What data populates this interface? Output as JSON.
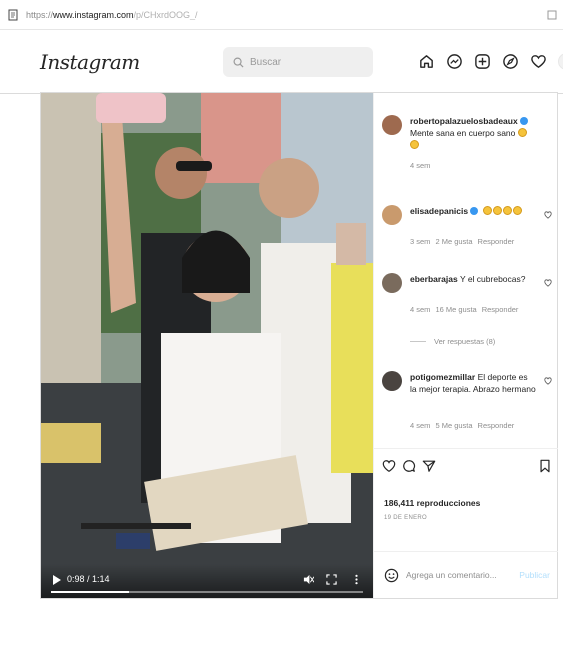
{
  "browser": {
    "url_scheme": "https://",
    "url_host": "www.instagram.com",
    "url_path": "/p/CHxrdOOG_/"
  },
  "nav": {
    "logo": "Instagram",
    "search_placeholder": "Buscar",
    "icons": [
      "home-icon",
      "messenger-icon",
      "new-post-icon",
      "explore-icon",
      "activity-heart-icon",
      "profile-avatar"
    ]
  },
  "video": {
    "time": "0:98 / 1:14",
    "progress_fraction": 0.25
  },
  "caption": {
    "username": "robertopalazuelosbadeaux",
    "text": "Mente sana en cuerpo sano",
    "time": "4 sem"
  },
  "comments": [
    {
      "username": "elisadepanicis",
      "text": "",
      "time": "3 sem",
      "likes": "2 Me gusta",
      "reply": "Responder"
    },
    {
      "username": "eberbarajas",
      "text": "Y el cubrebocas?",
      "time": "4 sem",
      "likes": "16 Me gusta",
      "reply": "Responder"
    },
    {
      "username": "potigomezmillar",
      "text": "El deporte es la mejor terapia. Abrazo hermano",
      "time": "4 sem",
      "likes": "5 Me gusta",
      "reply": "Responder"
    }
  ],
  "view_replies": "Ver respuestas (8)",
  "stats": {
    "views": "186,411 reproducciones",
    "date": "19 DE ENERO"
  },
  "composer": {
    "placeholder": "Agrega un comentario...",
    "publish": "Publicar"
  },
  "colors": {
    "verified": "#3897f0",
    "publish_disabled": "#b2dffc",
    "border": "#dbdbdb"
  }
}
